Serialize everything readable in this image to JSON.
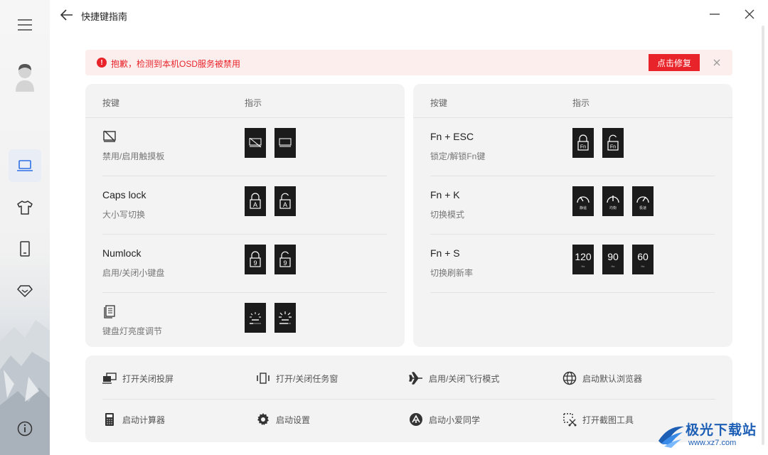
{
  "window": {
    "title": "快捷键指南"
  },
  "alert": {
    "message": "抱歉，检测到本机OSD服务被禁用",
    "fix_label": "点击修复",
    "color": "#e8242a"
  },
  "left_panel": {
    "header_key": "按键",
    "header_hint": "指示",
    "rows": [
      {
        "key": "",
        "icon": "touchpad-disabled-icon",
        "desc": "禁用/启用触摸板",
        "tiles": [
          "touchpad-off-icon",
          "touchpad-on-icon"
        ]
      },
      {
        "key": "Caps lock",
        "desc": "大小写切换",
        "tiles": [
          "caps-lock-icon",
          "caps-unlock-icon"
        ]
      },
      {
        "key": "Numlock",
        "desc": "启用/关闭小键盘",
        "tiles": [
          "num-lock-icon",
          "num-unlock-icon"
        ]
      },
      {
        "key": "",
        "icon": "keyboard-light-icon",
        "desc": "键盘灯亮度调节",
        "tiles": [
          "backlight-low-icon",
          "backlight-high-icon"
        ]
      }
    ]
  },
  "right_panel": {
    "header_key": "按键",
    "header_hint": "指示",
    "rows": [
      {
        "key": "Fn + ESC",
        "desc": "锁定/解锁Fn键",
        "tiles": [
          "fn-lock-icon",
          "fn-unlock-icon"
        ]
      },
      {
        "key": "Fn + K",
        "desc": "切换模式",
        "tiles": [
          {
            "label": "静谧"
          },
          {
            "label": "均衡"
          },
          {
            "label": "极速"
          }
        ]
      },
      {
        "key": "Fn + S",
        "desc": "切换刷新率",
        "tiles": [
          {
            "value": "120",
            "unit": "Hz"
          },
          {
            "value": "90",
            "unit": "Hz"
          },
          {
            "value": "60",
            "unit": "Hz"
          }
        ]
      }
    ]
  },
  "actions": [
    {
      "label": "打开关闭投屏",
      "icon": "screen-cast-icon"
    },
    {
      "label": "打开/关闭任务窗",
      "icon": "task-window-icon"
    },
    {
      "label": "启用/关闭飞行模式",
      "icon": "airplane-icon"
    },
    {
      "label": "启动默认浏览器",
      "icon": "globe-icon"
    },
    {
      "label": "启动计算器",
      "icon": "calculator-icon"
    },
    {
      "label": "启动设置",
      "icon": "gear-icon"
    },
    {
      "label": "启动小爱同学",
      "icon": "xiaoai-icon"
    },
    {
      "label": "打开截图工具",
      "icon": "screenshot-icon"
    }
  ],
  "watermark": {
    "name": "极光下载站",
    "url": "www.xz7.com"
  }
}
